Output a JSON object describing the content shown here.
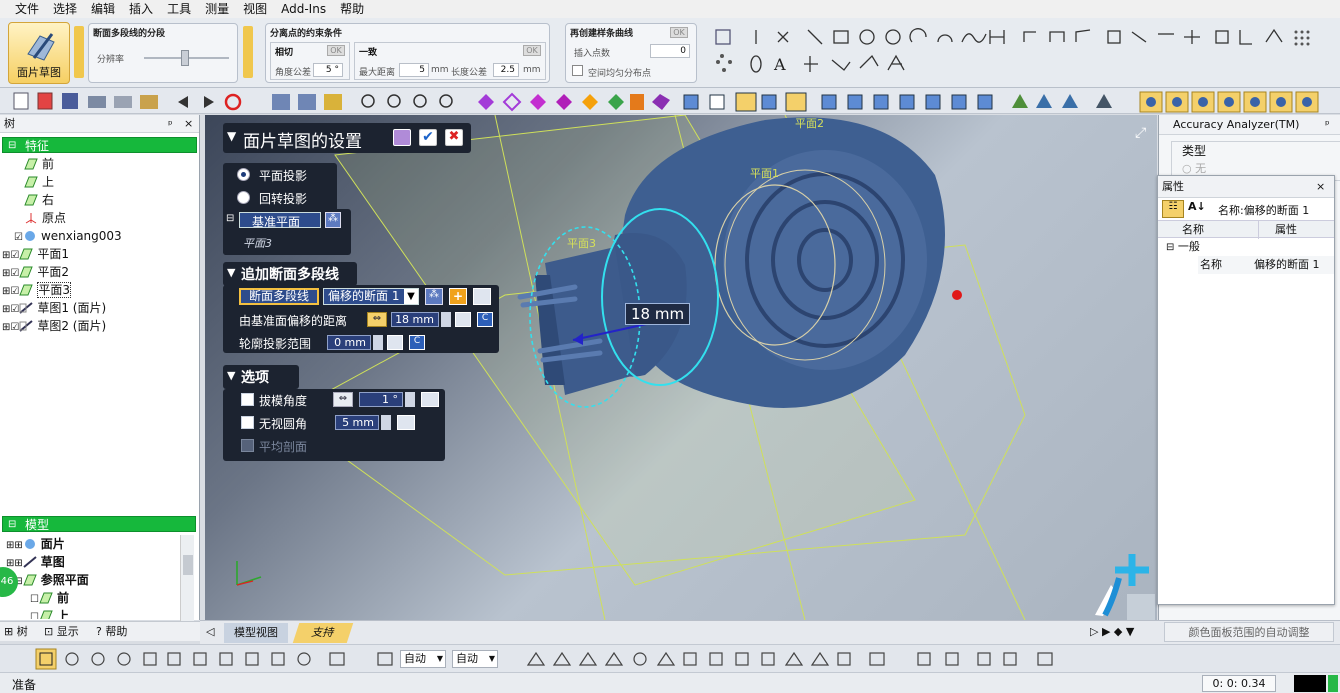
{
  "menu": [
    "文件",
    "选择",
    "编辑",
    "插入",
    "工具",
    "测量",
    "视图",
    "Add-Ins",
    "帮助"
  ],
  "ribbon": {
    "face_sketch_label": "面片草图",
    "seg_title": "断面多段线的分段",
    "seg_resolution": "分辨率",
    "split_title": "分离点的约束条件",
    "tangent_label": "相切",
    "tangent_tol_label": "角度公差",
    "tangent_tol_value": "5 °",
    "consistent_label": "一致",
    "max_dist_label": "最大距离",
    "max_dist_value": "5",
    "max_dist_unit": "mm",
    "len_tol_label": "长度公差",
    "len_tol_value": "2.5",
    "len_tol_unit": "mm",
    "ok": "OK",
    "recreate_title": "再创建样条曲线",
    "insert_points_label": "插入点数",
    "insert_points_value": "0",
    "uniform_label": "空间均匀分布点"
  },
  "tree": {
    "header": "树",
    "features_label": "特征",
    "items": [
      "前",
      "上",
      "右",
      "原点",
      "wenxiang003",
      "平面1",
      "平面2",
      "平面3",
      "草图1 (面片)",
      "草图2 (面片)"
    ],
    "model_label": "模型",
    "model_items": [
      "面片",
      "草图",
      "参照平面",
      "前",
      "上"
    ],
    "badge": "46",
    "bottom_tabs": [
      "树",
      "显示",
      "帮助"
    ]
  },
  "dialog": {
    "title": "面片草图的设置",
    "plane_projection": "平面投影",
    "rotate_projection": "回转投影",
    "base_plane": "基准平面",
    "base_plane_value": "平面3",
    "add_section_title": "追加断面多段线",
    "section_polyline_btn": "断面多段线",
    "section_select": "偏移的断面 1",
    "offset_label": "由基准面偏移的距离",
    "offset_value": "18 mm",
    "contour_label": "轮廓投影范围",
    "contour_value": "0 mm",
    "options_title": "选项",
    "draft_angle": "拔模角度",
    "draft_value": "1 °",
    "invisible_fillet": "无视圆角",
    "fillet_value": "5 mm",
    "avg_section": "平均剖面"
  },
  "viewport": {
    "dim_label": "18 mm",
    "plane1": "平面1",
    "plane2": "平面2",
    "plane3": "平面3"
  },
  "right": {
    "analyzer_title": "Accuracy Analyzer(TM)",
    "type_label": "类型",
    "none_label": "无",
    "props_title": "属性",
    "name_head": "名称",
    "name_value": "名称:偏移的断面 1",
    "col_name": "名称",
    "col_prop": "属性",
    "general": "一般",
    "row_name": "名称",
    "row_value": "偏移的断面 1",
    "auto_adjust": "颜色面板范围的自动调整"
  },
  "bottom": {
    "tab_model_view": "模型视图",
    "tab_support": "支持"
  },
  "toolbar3": {
    "auto1": "自动",
    "auto2": "自动"
  },
  "status": {
    "ready": "准备",
    "time": "0: 0: 0.34"
  },
  "colors": {
    "accent_green": "#16b83c",
    "dialog_bg": "#1c2330",
    "mesh": "#3e5f91",
    "circle": "#33e0ee",
    "highlight": "#f4d06a"
  }
}
